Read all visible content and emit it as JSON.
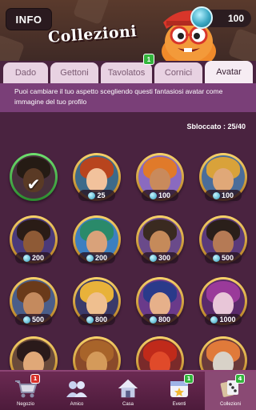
{
  "header": {
    "info_label": "INFO",
    "coins": "100",
    "title": "Collezioni"
  },
  "tabs": [
    {
      "label": "Dado",
      "active": false
    },
    {
      "label": "Gettoni",
      "active": false
    },
    {
      "label": "Tavolatos",
      "active": false,
      "badge": "1"
    },
    {
      "label": "Cornici",
      "active": false
    },
    {
      "label": "Avatar",
      "active": true
    }
  ],
  "description": "Puoi cambiare il tuo aspetto scegliendo questi fantasiosi avatar come immagine del tuo profilo",
  "unlocked": "Sbloccato :  25/40",
  "avatars": [
    {
      "price": null,
      "owned": true,
      "skin": "#8a5a3a",
      "hair": "#3a2a20",
      "bg": "#6d4a5c"
    },
    {
      "price": "25",
      "skin": "#f2c29c",
      "hair": "#b8441e",
      "bg": "#3d6a8a"
    },
    {
      "price": "100",
      "skin": "#c98a5c",
      "hair": "#e07a2a",
      "bg": "#8a6ac0"
    },
    {
      "price": "100",
      "skin": "#e0a878",
      "hair": "#d9a23a",
      "bg": "#4a6d9a"
    },
    {
      "price": "200",
      "skin": "#8e5a36",
      "hair": "#2a1c16",
      "bg": "#4a3a7a"
    },
    {
      "price": "200",
      "skin": "#d9a27a",
      "hair": "#2a8a6a",
      "bg": "#3c7fc0"
    },
    {
      "price": "300",
      "skin": "#c58a5a",
      "hair": "#3a2a20",
      "bg": "#6a4a8a"
    },
    {
      "price": "500",
      "skin": "#b57a55",
      "hair": "#2a1f1a",
      "bg": "#5a3a7a"
    },
    {
      "price": "500",
      "skin": "#c48a5e",
      "hair": "#6a3a1a",
      "bg": "#4a5e8a"
    },
    {
      "price": "800",
      "skin": "#efbf8f",
      "hair": "#e8b23a",
      "bg": "#3a3a6a"
    },
    {
      "price": "800",
      "skin": "#e6b08a",
      "hair": "#2a3a8a",
      "bg": "#6a3a8a"
    },
    {
      "price": "1000",
      "skin": "#e8c6d8",
      "hair": "#9a3a9a",
      "bg": "#5a2a6a"
    },
    {
      "price": null,
      "skin": "#e0a878",
      "hair": "#2a1a1a",
      "bg": "#6a4a3a",
      "partial": true
    },
    {
      "price": null,
      "skin": "#d49a5a",
      "hair": "#a8642a",
      "bg": "#8a4a2a",
      "partial": true
    },
    {
      "price": null,
      "skin": "#e04a2a",
      "hair": "#c02a1a",
      "bg": "#7a2a2a",
      "partial": true
    },
    {
      "price": null,
      "skin": "#d8d2c8",
      "hair": "#e07a3a",
      "bg": "#6a3a3a",
      "partial": true
    }
  ],
  "nav": [
    {
      "label": "Negozio",
      "badge": "1",
      "badge_color": "#d9322a",
      "icon": "cart-icon"
    },
    {
      "label": "Amico",
      "badge": null,
      "icon": "friends-icon"
    },
    {
      "label": "Casa",
      "badge": null,
      "icon": "home-icon"
    },
    {
      "label": "Eventi",
      "badge": "1",
      "badge_color": "#34b53d",
      "icon": "events-icon"
    },
    {
      "label": "Collezioni",
      "badge": "4",
      "badge_color": "#34b53d",
      "icon": "collections-icon",
      "active": true
    }
  ],
  "colors": {
    "accent": "#7a3f78",
    "background": "#4a2340",
    "gold": "#f7d26a"
  }
}
